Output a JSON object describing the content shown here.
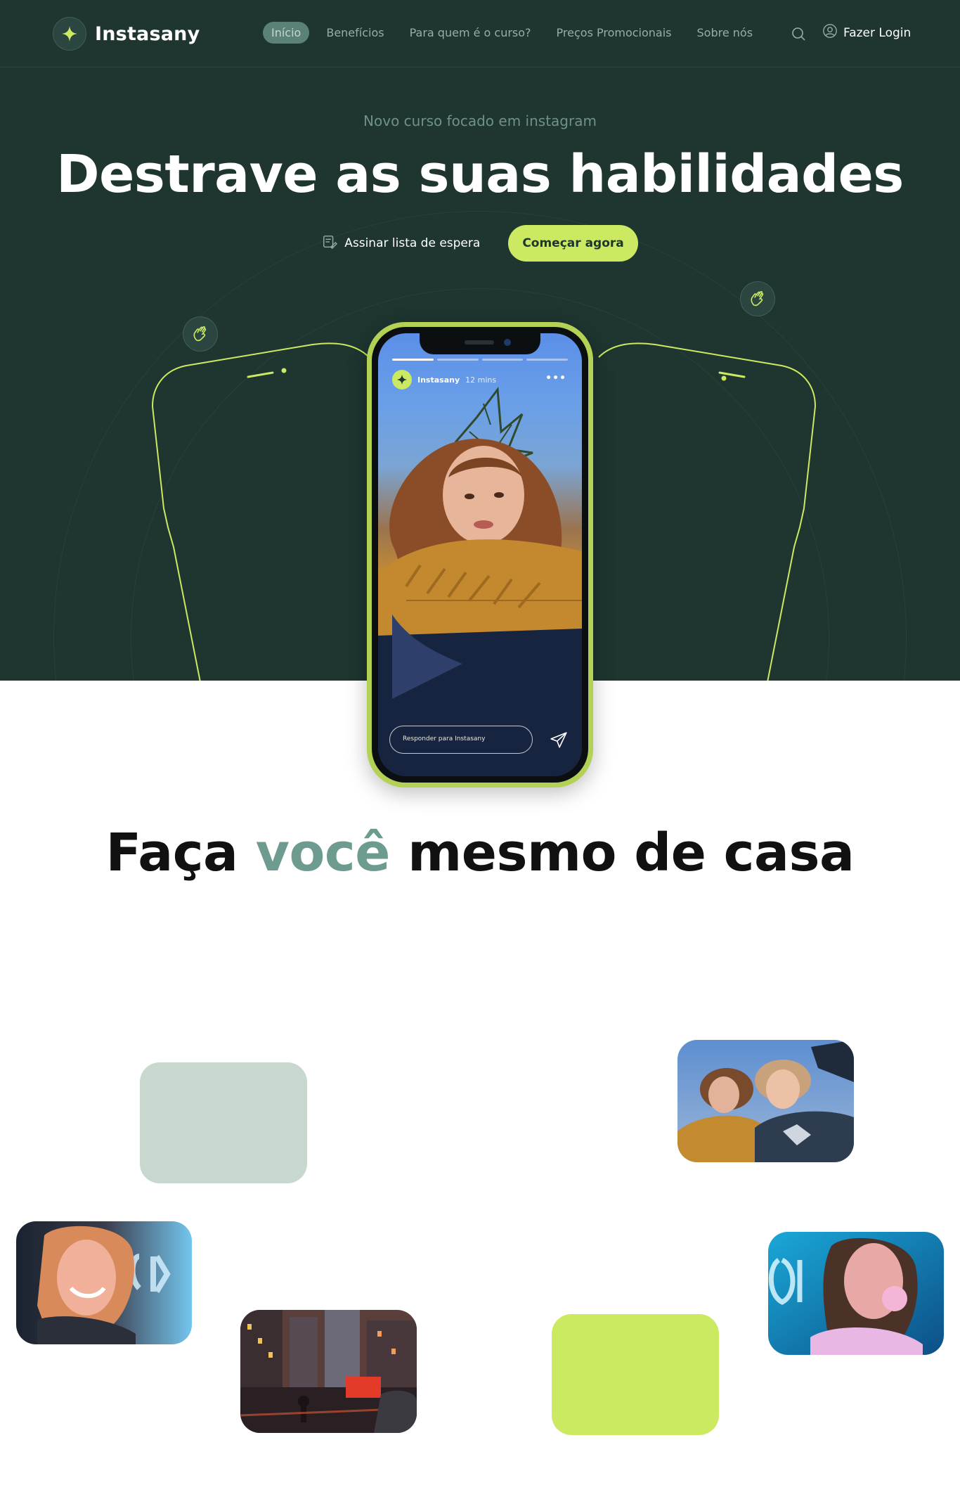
{
  "brand": {
    "name": "Instasany",
    "accent_color": "#cbea61",
    "hero_bg": "#1e3530"
  },
  "nav": {
    "items": [
      {
        "label": "Início",
        "active": true
      },
      {
        "label": "Benefícios",
        "active": false
      },
      {
        "label": "Para quem é o curso?",
        "active": false
      },
      {
        "label": "Preços Promocionais",
        "active": false
      },
      {
        "label": "Sobre nós",
        "active": false
      }
    ],
    "search_icon": "search-icon",
    "login_label": "Fazer Login",
    "login_icon": "user-circle-icon"
  },
  "hero": {
    "eyebrow": "Novo curso focado em instagram",
    "title": "Destrave as suas habilidades",
    "waitlist_label": "Assinar lista de espera",
    "waitlist_icon": "note-edit-icon",
    "cta_label": "Começar agora",
    "badge_icon": "clapping-hands-icon"
  },
  "phone": {
    "story_user": "Instasany",
    "story_time": "12 mins",
    "menu_icon": "more-dots-icon",
    "reply_placeholder": "Responder para Instasany",
    "send_icon": "send-icon"
  },
  "section": {
    "title_before": "Faça",
    "title_accent": "você",
    "title_after": "mesmo de casa",
    "accent_color": "#6e9b8f"
  },
  "cards": [
    {
      "kind": "placeholder",
      "color": "#c9d8cf"
    },
    {
      "kind": "photo",
      "subject": "two-girls-photo"
    },
    {
      "kind": "photo",
      "subject": "smiling-girl-neon-photo"
    },
    {
      "kind": "photo",
      "subject": "city-street-photo"
    },
    {
      "kind": "placeholder",
      "color": "#cbea61"
    },
    {
      "kind": "photo",
      "subject": "bubblegum-girl-photo"
    }
  ]
}
